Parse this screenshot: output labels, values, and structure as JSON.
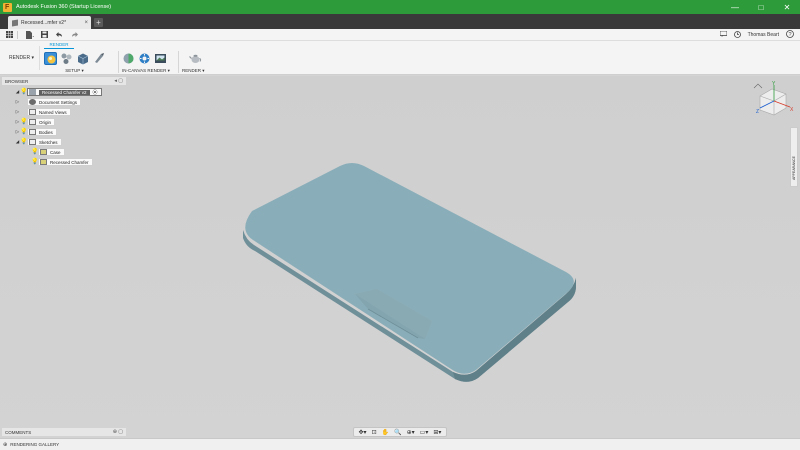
{
  "window": {
    "title": "Autodesk Fusion 360 (Startup License)",
    "minimize_glyph": "—",
    "maximize_glyph": "□",
    "close_glyph": "✕"
  },
  "tabs": {
    "active_label": "Recessed...mfer v2*",
    "close_glyph": "×",
    "new_tab_glyph": "+"
  },
  "quick_access": {
    "user_name": "Thomas Beart",
    "help_glyph": "?"
  },
  "ribbon": {
    "workspace": "RENDER ▾",
    "active_tab": "RENDER",
    "groups": [
      {
        "label": "SETUP ▾"
      },
      {
        "label": "IN-CANVAS RENDER ▾"
      },
      {
        "label": "RENDER ▾"
      }
    ]
  },
  "browser": {
    "title": "BROWSER",
    "root": "Recessed Chamfer v2",
    "items": {
      "doc_settings": "Document Settings",
      "named_views": "Named Views",
      "origin": "Origin",
      "bodies": "Bodies",
      "sketches": "Sketches",
      "case": "Case",
      "recessed_chamfer": "Recessed Chamfer"
    }
  },
  "side_tab": "APPEARANCE",
  "comments": {
    "title": "COMMENTS"
  },
  "gallery": {
    "title": "RENDERING GALLERY"
  },
  "viewcube": {
    "axis_y": "Y",
    "axis_z": "Z",
    "axis_x": "X"
  },
  "colors": {
    "title_bar": "#2e9b3a",
    "tab_bar": "#3a3a3a",
    "accent": "#0696d7",
    "model_top": "#8aaeb9",
    "model_side": "#6f8f99"
  },
  "icons": {
    "grid": "grid-icon",
    "file": "file-icon",
    "save": "save-icon",
    "undo": "undo-icon",
    "redo": "redo-icon",
    "history": "clock-icon",
    "help": "help-icon"
  }
}
